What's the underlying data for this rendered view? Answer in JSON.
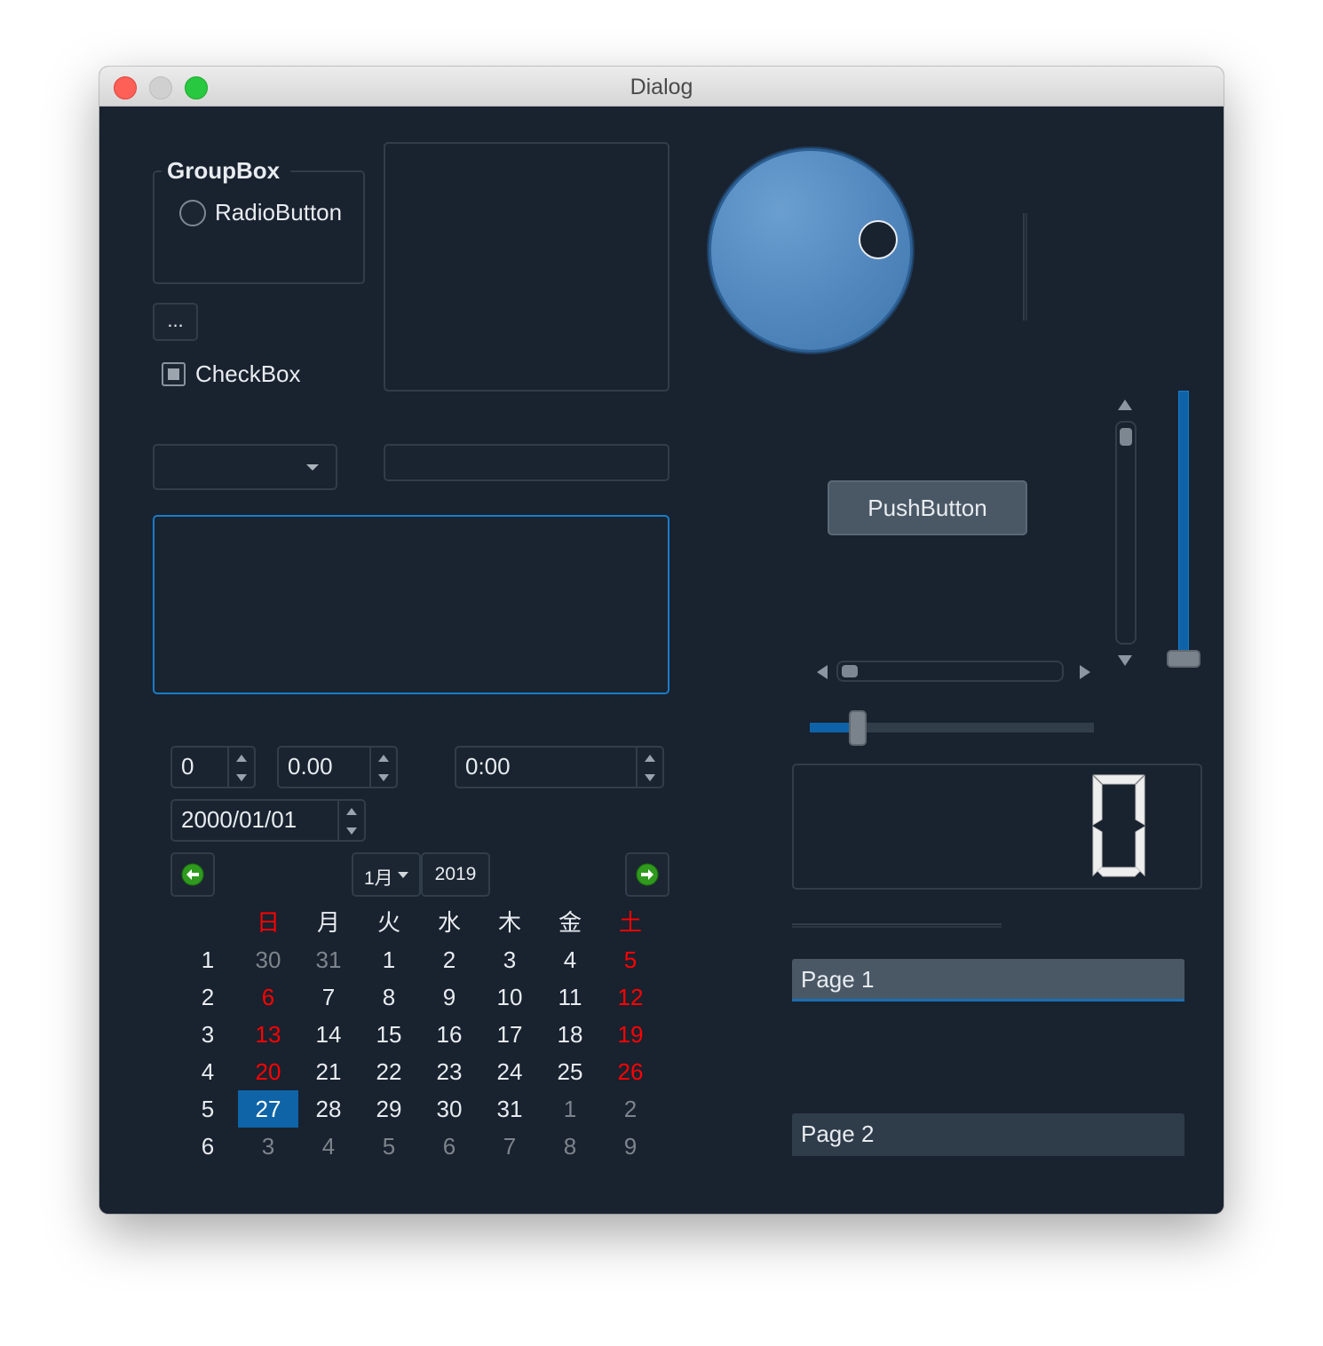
{
  "window": {
    "title": "Dialog"
  },
  "groupbox": {
    "title": "GroupBox",
    "radio_label": "RadioButton"
  },
  "tool_button": {
    "label": "..."
  },
  "checkbox": {
    "label": "CheckBox"
  },
  "push_button": {
    "label": "PushButton"
  },
  "spinbox": {
    "value": "0"
  },
  "double_spinbox": {
    "value": "0.00"
  },
  "time_edit": {
    "value": "0:00"
  },
  "date_edit": {
    "value": "2000/01/01"
  },
  "calendar": {
    "month": "1月",
    "year": "2019",
    "weekdays": [
      "日",
      "月",
      "火",
      "水",
      "木",
      "金",
      "土"
    ],
    "week_numbers": [
      "1",
      "2",
      "3",
      "4",
      "5",
      "6"
    ],
    "weeks": [
      [
        "30",
        "31",
        "1",
        "2",
        "3",
        "4",
        "5"
      ],
      [
        "6",
        "7",
        "8",
        "9",
        "10",
        "11",
        "12"
      ],
      [
        "13",
        "14",
        "15",
        "16",
        "17",
        "18",
        "19"
      ],
      [
        "20",
        "21",
        "22",
        "23",
        "24",
        "25",
        "26"
      ],
      [
        "27",
        "28",
        "29",
        "30",
        "31",
        "1",
        "2"
      ],
      [
        "3",
        "4",
        "5",
        "6",
        "7",
        "8",
        "9"
      ]
    ],
    "selected": "27",
    "colors": {
      "weekend": "#ff0000",
      "other_month": "#7d848c",
      "normal": "#e8ecf0",
      "selected_bg": "#0e64a7"
    }
  },
  "lcd": {
    "value": "0"
  },
  "toolbox": {
    "pages": [
      "Page 1",
      "Page 2"
    ]
  },
  "horizontal_slider": {
    "value_fraction": 0.17
  },
  "vertical_slider": {
    "value_fraction": 0.0
  },
  "dial": {
    "value_fraction": 0.25
  },
  "colors": {
    "background": "#19222f",
    "accent": "#1a6fb4",
    "border": "#323d4a",
    "button": "#4a5866"
  },
  "icons": {
    "calendar_prev": "green-left-arrow-icon",
    "calendar_next": "green-right-arrow-icon",
    "combo_arrow": "chevron-down-icon",
    "window_close": "close-icon",
    "window_minimize": "minimize-icon",
    "window_maximize": "maximize-icon"
  }
}
